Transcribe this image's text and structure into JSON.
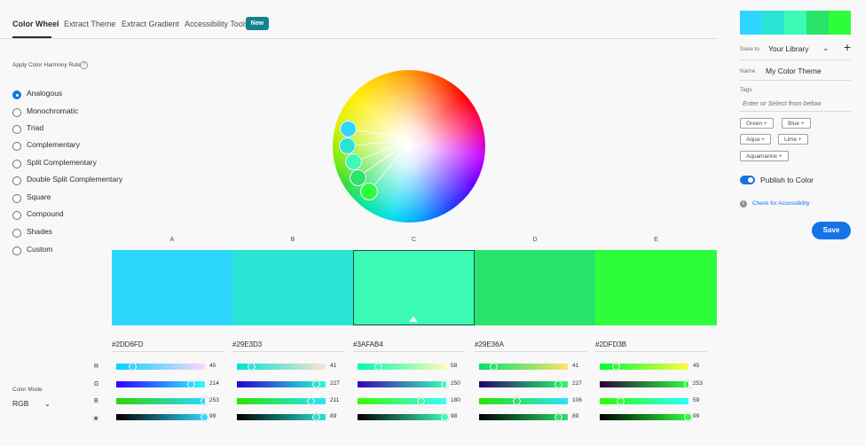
{
  "tabs": [
    {
      "label": "Color Wheel",
      "active": true
    },
    {
      "label": "Extract Theme",
      "active": false
    },
    {
      "label": "Extract Gradient",
      "active": false
    },
    {
      "label": "Accessibility Tools",
      "active": false
    }
  ],
  "new_badge": "New",
  "harmony": {
    "title": "Apply Color Harmony Rule",
    "help_icon": "?",
    "options": [
      "Analogous",
      "Monochromatic",
      "Triad",
      "Complementary",
      "Split Complementary",
      "Double Split Complementary",
      "Square",
      "Compound",
      "Shades",
      "Custom"
    ],
    "selected": "Analogous"
  },
  "color_mode": {
    "label": "Color Mode",
    "value": "RGB",
    "chevron": "⌄"
  },
  "row_labels": [
    "R",
    "G",
    "B",
    "☀"
  ],
  "swatches": [
    {
      "letter": "A",
      "hex": "#2DD6FD",
      "rgb": [
        45,
        214,
        253
      ],
      "brightness": 99,
      "selected": false
    },
    {
      "letter": "B",
      "hex": "#29E3D3",
      "rgb": [
        41,
        227,
        211
      ],
      "brightness": 89,
      "selected": false
    },
    {
      "letter": "C",
      "hex": "#3AFAB4",
      "rgb": [
        58,
        250,
        180
      ],
      "brightness": 98,
      "selected": true
    },
    {
      "letter": "D",
      "hex": "#29E36A",
      "rgb": [
        41,
        227,
        106
      ],
      "brightness": 89,
      "selected": false
    },
    {
      "letter": "E",
      "hex": "#2DFD3B",
      "rgb": [
        45,
        253,
        59
      ],
      "brightness": 99,
      "selected": false
    }
  ],
  "right_panel": {
    "save_to_label": "Save to",
    "save_to_value": "Your Library",
    "chevron": "⌄",
    "plus": "+",
    "name_label": "Name",
    "name_value": "My Color Theme",
    "tags_label": "Tags",
    "tags_placeholder": "Enter or Select from below",
    "tags": [
      "Green +",
      "Blue +",
      "Aqua +",
      "Lime +",
      "Aquamarine +"
    ],
    "publish_label": "Publish to Color",
    "publish_on": true,
    "info_icon": "i",
    "accessibility_link": "Check for Accessibility",
    "save_button": "Save"
  },
  "colors": {
    "accent": "#1473e6",
    "badge": "#12838e",
    "text": "#2c2c2c"
  }
}
